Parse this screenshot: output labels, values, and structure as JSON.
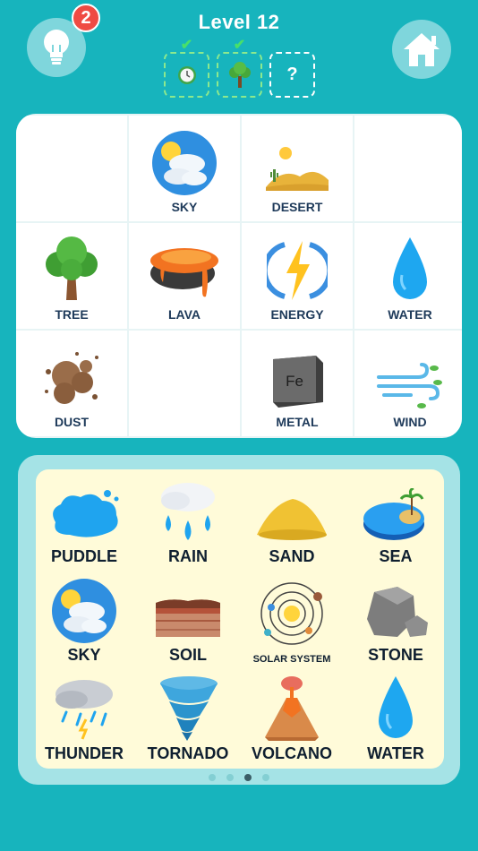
{
  "header": {
    "level_title": "Level 12",
    "hint_count": "2",
    "slots": [
      {
        "icon": "clock-icon",
        "checked": true
      },
      {
        "icon": "tree-icon",
        "checked": true
      },
      {
        "label": "?"
      }
    ]
  },
  "board": {
    "cells": [
      {
        "label": ""
      },
      {
        "label": "SKY",
        "icon": "sky-icon"
      },
      {
        "label": "DESERT",
        "icon": "desert-icon"
      },
      {
        "label": ""
      },
      {
        "label": "TREE",
        "icon": "tree-icon"
      },
      {
        "label": "LAVA",
        "icon": "lava-icon"
      },
      {
        "label": "ENERGY",
        "icon": "energy-icon"
      },
      {
        "label": "WATER",
        "icon": "water-drop-icon"
      },
      {
        "label": "DUST",
        "icon": "dust-icon"
      },
      {
        "label": ""
      },
      {
        "label": "METAL",
        "icon": "metal-icon",
        "symbol": "Fe"
      },
      {
        "label": "WIND",
        "icon": "wind-icon"
      }
    ]
  },
  "inventory": {
    "items": [
      {
        "label": "PUDDLE",
        "icon": "puddle-icon"
      },
      {
        "label": "RAIN",
        "icon": "rain-icon"
      },
      {
        "label": "SAND",
        "icon": "sand-icon"
      },
      {
        "label": "SEA",
        "icon": "sea-icon"
      },
      {
        "label": "SKY",
        "icon": "sky-icon"
      },
      {
        "label": "SOIL",
        "icon": "soil-icon"
      },
      {
        "label": "SOLAR SYSTEM",
        "icon": "solar-system-icon"
      },
      {
        "label": "STONE",
        "icon": "stone-icon"
      },
      {
        "label": "THUNDER",
        "icon": "thunder-icon"
      },
      {
        "label": "TORNADO",
        "icon": "tornado-icon"
      },
      {
        "label": "VOLCANO",
        "icon": "volcano-icon"
      },
      {
        "label": "WATER",
        "icon": "water-drop-icon"
      }
    ],
    "page_count": 4,
    "current_page": 3
  }
}
